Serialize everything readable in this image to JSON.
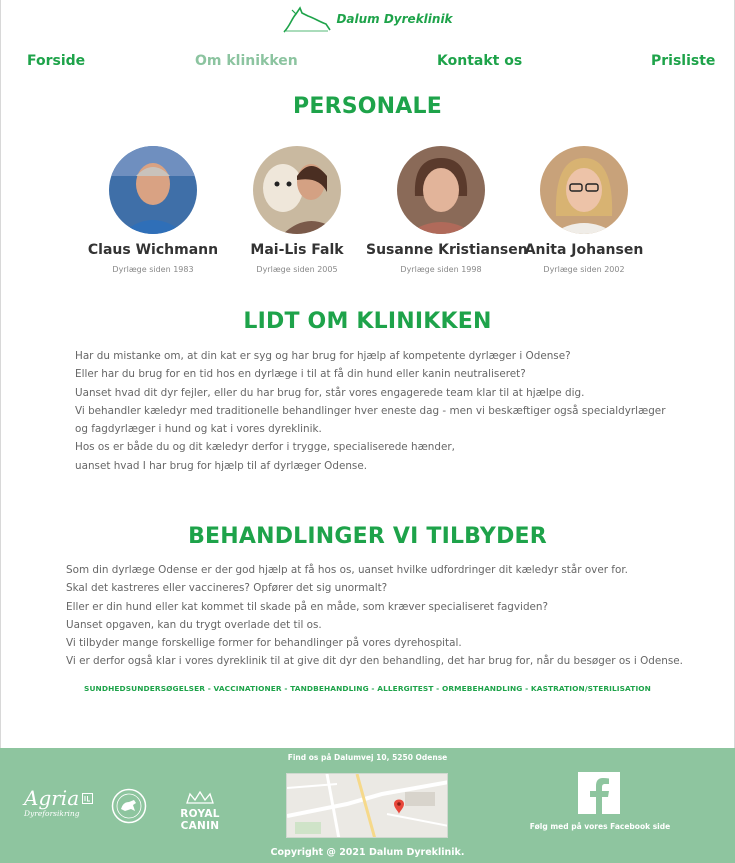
{
  "header": {
    "logo_text": "Dalum Dyreklinik"
  },
  "nav": {
    "items": [
      {
        "label": "Forside",
        "active": false
      },
      {
        "label": "Om klinikken",
        "active": true
      },
      {
        "label": "Kontakt os",
        "active": false
      },
      {
        "label": "Prisliste",
        "active": false
      }
    ]
  },
  "personale": {
    "title": "PERSONALE",
    "staff": [
      {
        "name": "Claus Wichmann",
        "since": "Dyrlæge siden 1983"
      },
      {
        "name": "Mai-Lis Falk",
        "since": "Dyrlæge siden 2005"
      },
      {
        "name": "Susanne Kristiansen",
        "since": "Dyrlæge siden 1998"
      },
      {
        "name": "Anita Johansen",
        "since": "Dyrlæge siden 2002"
      }
    ]
  },
  "about": {
    "title": "LIDT OM KLINIKKEN",
    "lines": [
      "Har du mistanke om, at din kat er syg og har brug for hjælp af kompetente dyrlæger i Odense?",
      "Eller har du brug for en tid hos en dyrlæge i til at få din hund eller kanin neutraliseret?",
      "Uanset hvad dit dyr fejler, eller du har brug for, står vores engagerede team klar til at hjælpe dig.",
      "Vi behandler kæledyr med traditionelle behandlinger hver eneste dag - men vi beskæftiger også specialdyrlæger",
      "og fagdyrlæger i hund og kat i vores dyreklinik.",
      "Hos os er både du og dit kæledyr derfor i trygge, specialiserede hænder,",
      "uanset hvad I har brug for hjælp til af dyrlæger Odense."
    ]
  },
  "treatments": {
    "title": "BEHANDLINGER VI TILBYDER",
    "lines": [
      "Som din dyrlæge Odense er der god hjælp at få hos os, uanset hvilke udfordringer dit kæledyr står over for.",
      "Skal det kastreres eller vaccineres? Opfører det sig unormalt?",
      "Eller er din hund eller kat kommet til skade på en måde, som kræver specialiseret fagviden?",
      "Uanset opgaven, kan du trygt overlade det til os.",
      "Vi tilbyder mange forskellige former for behandlinger på vores dyrehospital.",
      "Vi er derfor også klar i vores dyreklinik til at give dit dyr den behandling, det har brug for, når du besøger os i Odense."
    ],
    "list": "SUNDHEDSUNDERSØGELSER - VACCINATIONER - TANDBEHANDLING - ALLERGITEST - ORMEBEHANDLING - KASTRATION/STERILISATION"
  },
  "footer": {
    "find_us": "Find os på Dalumvej 10, 5250 Odense",
    "facebook_text": "Følg med på vores Facebook side",
    "copyright": "Copyright @ 2021 Dalum Dyreklinik.",
    "sponsors": {
      "agria": "Agria",
      "agria_sub": "Dyreforsikring",
      "royal_canin": "ROYAL CANIN"
    }
  },
  "colors": {
    "brand_green": "#1ea34a",
    "nav_active": "#8cc4a0",
    "footer_bg": "#8ec59f"
  }
}
